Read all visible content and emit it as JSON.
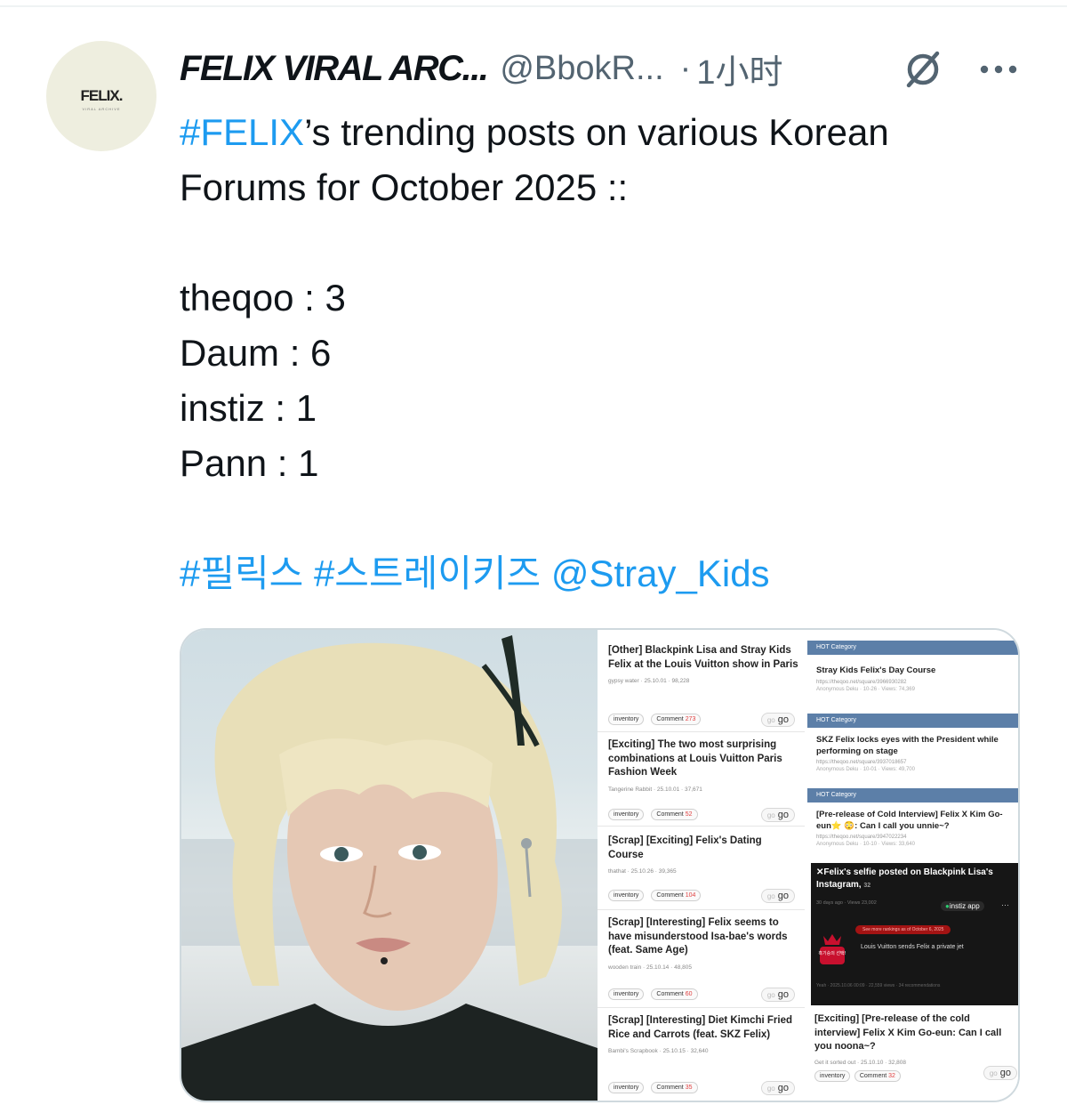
{
  "tweet": {
    "display_name": "FELIX VIRAL ARC...",
    "handle": "@BbokR...",
    "time_ago": "1小时",
    "avatar_logo": "FELIX.",
    "avatar_subtitle": "VIRAL ARCHIVE",
    "text": {
      "hashtag_felix": "#FELIX",
      "line1_rest": "’s trending posts on various Korean",
      "line2": "Forums for October 2025 ::",
      "stats": [
        "theqoo : 3",
        "Daum : 6",
        "instiz : 1",
        "Pann : 1"
      ],
      "tags": [
        "#필릭스",
        "#스트레이키즈",
        "@Stray_Kids"
      ]
    },
    "icons": {
      "grok": "grok-icon",
      "more": "more-options-icon"
    },
    "colors": {
      "link": "#1d9bf0",
      "secondary": "#536471",
      "hot_bar": "#5c7fa8"
    }
  },
  "media": {
    "left_column": [
      {
        "title": "[Other] Blackpink Lisa and Stray Kids Felix at the Louis Vuitton show in Paris",
        "meta": "gypsy water · 25.10.01 · 98,228",
        "inventory": "inventory",
        "comment_label": "Comment",
        "comment_count": "273",
        "go": "go"
      },
      {
        "title": "[Exciting] The two most surprising combinations at Louis Vuitton Paris Fashion Week",
        "meta": "Tangerine Rabbit · 25.10.01 · 37,671",
        "inventory": "inventory",
        "comment_label": "Comment",
        "comment_count": "52",
        "go": "go"
      },
      {
        "title": "[Scrap] [Exciting] Felix's Dating Course",
        "meta": "thathat · 25.10.26 · 39,365",
        "inventory": "inventory",
        "comment_label": "Comment",
        "comment_count": "104",
        "go": "go"
      },
      {
        "title": "[Scrap] [Interesting] Felix seems to have misunderstood Isa-bae's words (feat. Same Age)",
        "meta": "wooden train · 25.10.14 · 48,805",
        "inventory": "inventory",
        "comment_label": "Comment",
        "comment_count": "60",
        "go": "go"
      },
      {
        "title": "[Scrap] [Interesting] Diet Kimchi Fried Rice and Carrots (feat. SKZ Felix)",
        "meta": "Bambi's Scrapbook · 25.10.15 · 32,640",
        "inventory": "inventory",
        "comment_label": "Comment",
        "comment_count": "35",
        "go": "go"
      }
    ],
    "right_column": {
      "hot_label": "HOT Category",
      "hot_items": [
        {
          "title": "Stray Kids Felix's Day Course",
          "url": "https://theqoo.net/square/3966930282",
          "stat": "Anonymous Deku · 10-26 · Views: 74,369"
        },
        {
          "title": "SKZ Felix locks eyes with the President while performing on stage",
          "url": "https://theqoo.net/square/3937018657",
          "stat": "Anonymous Deku · 10-01 · Views: 49,700"
        },
        {
          "title": "[Pre-release of Cold Interview] Felix X Kim Go-eun⭐ 😳: Can I call you unnie~?",
          "url": "https://theqoo.net/square/3947022234",
          "stat": "Anonymous Deku · 10-10 · Views: 33,640"
        }
      ],
      "instiz_card": {
        "title": "✕Felix's selfie posted on Blackpink Lisa's Instagram,",
        "count": "32",
        "meta": "30 days ago · Views 23,002",
        "app": "instiz app",
        "ranking_pill": "See more rankings as of October 6, 2025",
        "headline": "Louis Vuitton sends Felix a private jet",
        "badge": "흑기승의 선택!",
        "stats": "Yeah · 2025.10.06 00:09 · 22,559 views · 34 recommendations"
      },
      "pann_post": {
        "title": "[Exciting] [Pre-release of the cold interview] Felix X Kim Go-eun: Can I call you noona~?",
        "meta": "Get it sorted out · 25.10.10 · 32,808",
        "inventory": "inventory",
        "comment_label": "Comment",
        "comment_count": "32",
        "go": "go"
      }
    }
  }
}
